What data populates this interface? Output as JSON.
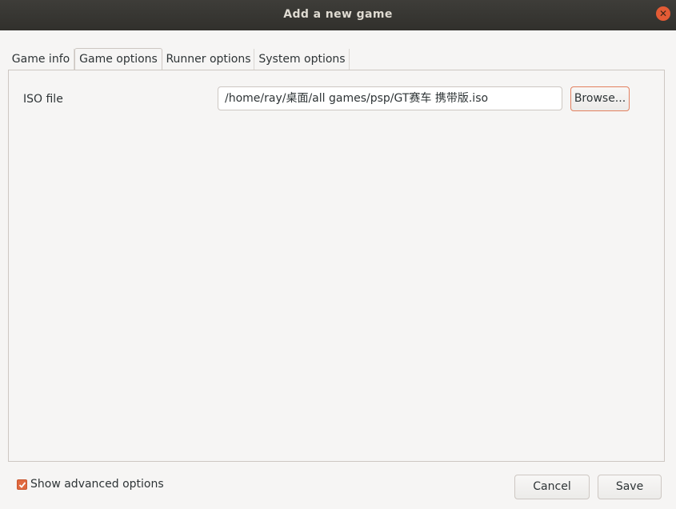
{
  "window": {
    "title": "Add a new game",
    "close_icon": "close-icon"
  },
  "tabs": [
    {
      "label": "Game info",
      "active": false
    },
    {
      "label": "Game options",
      "active": true
    },
    {
      "label": "Runner options",
      "active": false
    },
    {
      "label": "System options",
      "active": false
    }
  ],
  "game_options": {
    "iso_label": "ISO file",
    "iso_path": "/home/ray/桌面/all games/psp/GT赛车 携带版.iso",
    "browse_label": "Browse..."
  },
  "footer": {
    "advanced_label": "Show advanced options",
    "advanced_checked": true,
    "cancel_label": "Cancel",
    "save_label": "Save"
  },
  "colors": {
    "accent": "#e0693f",
    "titlebar": "#353430"
  }
}
